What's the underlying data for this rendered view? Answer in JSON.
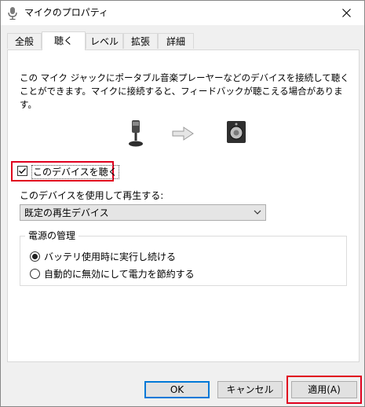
{
  "window": {
    "title": "マイクのプロパティ",
    "icon": "microphone-icon",
    "close_glyph": "✕"
  },
  "tabs": [
    {
      "label": "全般",
      "active": false
    },
    {
      "label": "聴く",
      "active": true
    },
    {
      "label": "レベル",
      "active": false
    },
    {
      "label": "拡張",
      "active": false
    },
    {
      "label": "詳細",
      "active": false
    }
  ],
  "listen": {
    "description": "この マイク ジャックにポータブル音楽プレーヤーなどのデバイスを接続して聴くことができます。マイクに接続すると、フィードバックが聴こえる場合があります。",
    "checkbox_label": "このデバイスを聴く",
    "checkbox_checked": true,
    "playback_label": "このデバイスを使用して再生する:",
    "playback_value": "既定の再生デバイス"
  },
  "power": {
    "title": "電源の管理",
    "options": [
      {
        "label": "バッテリ使用時に実行し続ける",
        "selected": true
      },
      {
        "label": "自動的に無効にして電力を節約する",
        "selected": false
      }
    ]
  },
  "buttons": {
    "ok": "OK",
    "cancel": "キャンセル",
    "apply": "適用(A)"
  },
  "colors": {
    "highlight": "#e0001e",
    "accent": "#0078d7"
  }
}
